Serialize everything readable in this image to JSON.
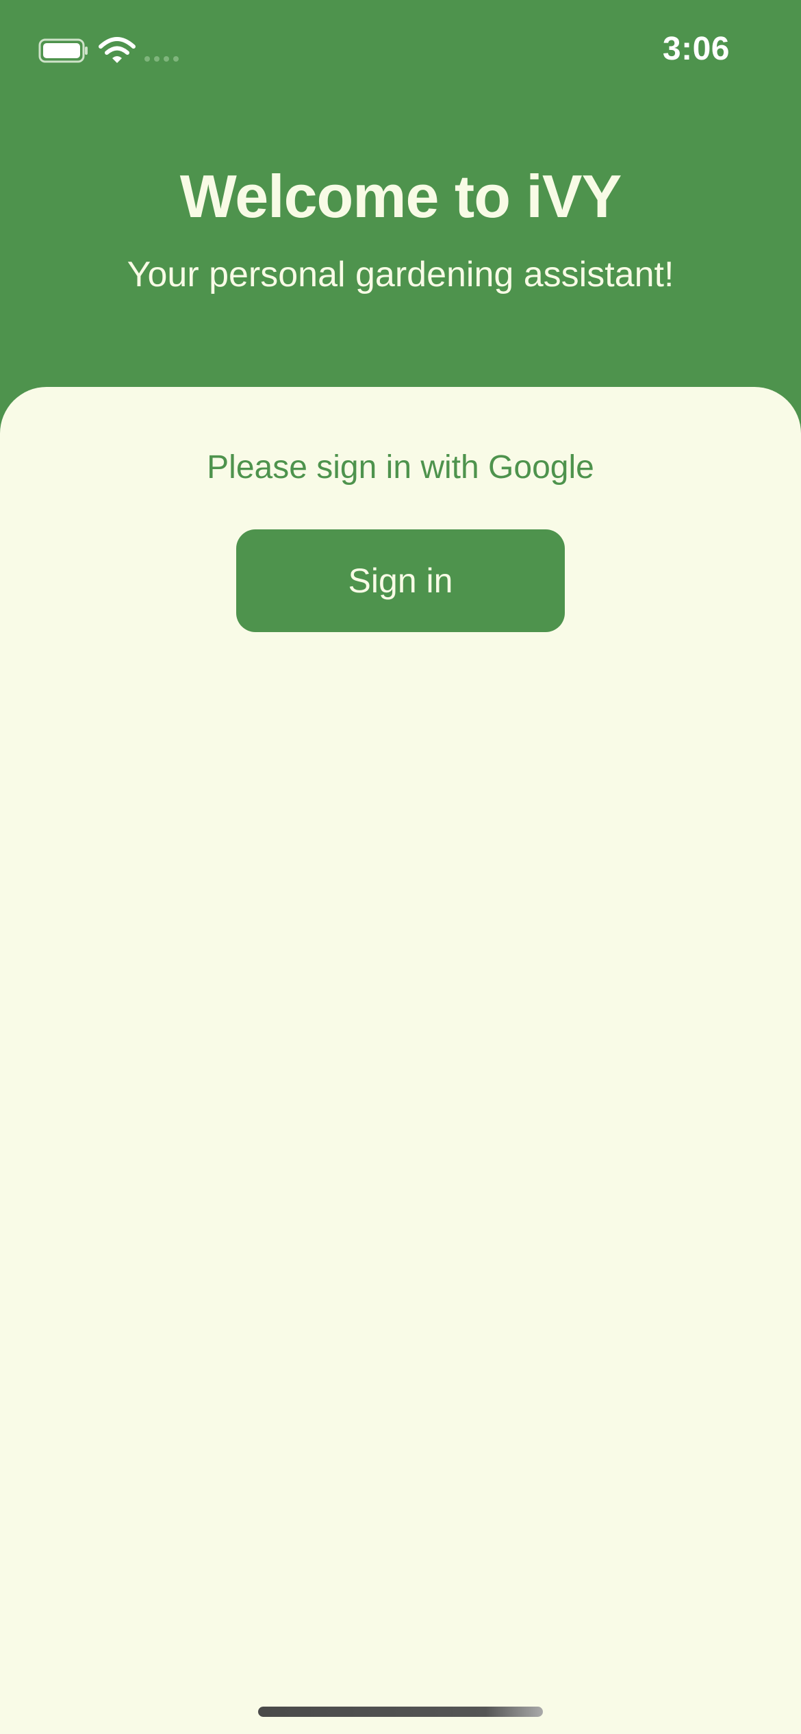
{
  "status_bar": {
    "time": "3:06",
    "icons": [
      "battery-icon",
      "wifi-icon",
      "signal-dots-icon"
    ]
  },
  "header": {
    "title": "Welcome to iVY",
    "subtitle": "Your personal gardening assistant!"
  },
  "sign_in": {
    "prompt": "Please sign in with Google",
    "button_label": "Sign in"
  },
  "colors": {
    "brand_green": "#4e934d",
    "card_background": "#f9fbe7",
    "header_text": "#f8fbe6"
  }
}
